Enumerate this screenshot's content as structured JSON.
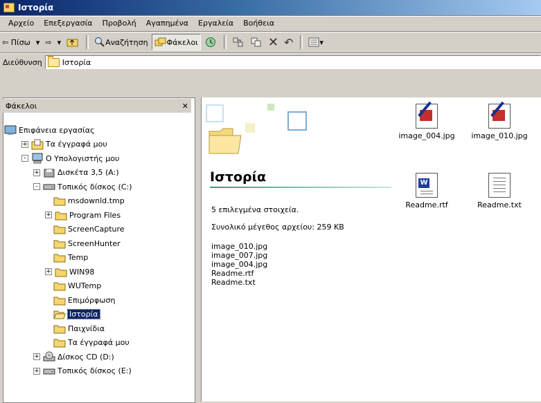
{
  "window": {
    "title": "Ιστορία"
  },
  "menu": [
    "Αρχείο",
    "Επεξεργασία",
    "Προβολή",
    "Αγαπημένα",
    "Εργαλεία",
    "Βοήθεια"
  ],
  "toolbar": {
    "back": "⇦ Πίσω",
    "back_drop": "▾",
    "forward": "⇨",
    "forward_drop": "▾",
    "search": "Αναζήτηση",
    "folders": "Φάκελοι",
    "delete_glyph": "✕",
    "undo_glyph": "↶",
    "views_drop": "▾"
  },
  "address": {
    "label": "Διεύθυνση",
    "value": "Ιστορία"
  },
  "folders_pane": {
    "title": "Φάκελοι",
    "close": "✕"
  },
  "tree": [
    {
      "label": "Επιφάνεια εργασίας",
      "level": 0,
      "expander": "",
      "icon": "desktop-icon"
    },
    {
      "label": "Τα έγγραφά μου",
      "level": 1,
      "expander": "+",
      "icon": "my-documents-icon"
    },
    {
      "label": "Ο Υπολογιστής μου",
      "level": 1,
      "expander": "-",
      "icon": "my-computer-icon"
    },
    {
      "label": "Δισκέτα 3,5 (A:)",
      "level": 2,
      "expander": "+",
      "icon": "floppy-icon"
    },
    {
      "label": "Τοπικός δίσκος (C:)",
      "level": 2,
      "expander": "-",
      "icon": "drive-icon"
    },
    {
      "label": "msdownld.tmp",
      "level": 3,
      "expander": "",
      "icon": "folder-icon"
    },
    {
      "label": "Program Files",
      "level": 3,
      "expander": "+",
      "icon": "folder-icon"
    },
    {
      "label": "ScreenCapture",
      "level": 3,
      "expander": "",
      "icon": "folder-icon"
    },
    {
      "label": "ScreenHunter",
      "level": 3,
      "expander": "",
      "icon": "folder-icon"
    },
    {
      "label": "Temp",
      "level": 3,
      "expander": "",
      "icon": "folder-icon"
    },
    {
      "label": "WIN98",
      "level": 3,
      "expander": "+",
      "icon": "folder-icon"
    },
    {
      "label": "WUTemp",
      "level": 3,
      "expander": "",
      "icon": "folder-icon"
    },
    {
      "label": "Επιμόρφωση",
      "level": 3,
      "expander": "",
      "icon": "folder-icon"
    },
    {
      "label": "Ιστορία",
      "level": 3,
      "expander": "",
      "icon": "open-folder-icon",
      "selected": true
    },
    {
      "label": "Παιχνίδια",
      "level": 3,
      "expander": "",
      "icon": "folder-icon"
    },
    {
      "label": "Τα έγγραφά μου",
      "level": 3,
      "expander": "",
      "icon": "folder-icon"
    },
    {
      "label": "Δίσκος CD (D:)",
      "level": 2,
      "expander": "+",
      "icon": "cd-drive-icon"
    },
    {
      "label": "Τοπικός δίσκος (E:)",
      "level": 2,
      "expander": "+",
      "icon": "drive-icon"
    }
  ],
  "info": {
    "title": "Ιστορία",
    "selected_count": "5 επιλεγμένα στοιχεία.",
    "total_size": "Συνολικό μέγεθος αρχείου: 259 KB",
    "selected_files": [
      "image_010.jpg",
      "image_007.jpg",
      "image_004.jpg",
      "Readme.rtf",
      "Readme.txt"
    ]
  },
  "files": [
    {
      "name": "image_004.jpg",
      "icon": "image-file-icon"
    },
    {
      "name": "image_010.jpg",
      "icon": "image-file-icon"
    },
    {
      "name": "Readme.rtf",
      "icon": "word-document-icon"
    },
    {
      "name": "Readme.txt",
      "icon": "text-file-icon"
    }
  ]
}
